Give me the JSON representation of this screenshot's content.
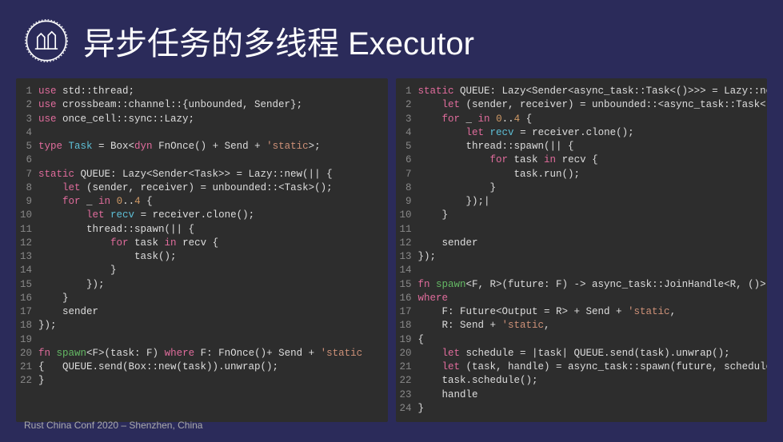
{
  "header": {
    "title": "异步任务的多线程 Executor"
  },
  "footer": {
    "text": "Rust China Conf 2020 – Shenzhen, China"
  },
  "left_code": [
    [
      {
        "t": "use ",
        "c": "kw"
      },
      {
        "t": "std::thread;",
        "c": ""
      }
    ],
    [
      {
        "t": "use ",
        "c": "kw"
      },
      {
        "t": "crossbeam::channel::{unbounded, Sender};",
        "c": ""
      }
    ],
    [
      {
        "t": "use ",
        "c": "kw"
      },
      {
        "t": "once_cell::sync::Lazy;",
        "c": ""
      }
    ],
    [
      {
        "t": "",
        "c": ""
      }
    ],
    [
      {
        "t": "type ",
        "c": "kw"
      },
      {
        "t": "Task",
        "c": "ty"
      },
      {
        "t": " = Box<",
        "c": ""
      },
      {
        "t": "dyn",
        "c": "kw"
      },
      {
        "t": " FnOnce() + Send + ",
        "c": ""
      },
      {
        "t": "'static",
        "c": "str"
      },
      {
        "t": ">;",
        "c": ""
      }
    ],
    [
      {
        "t": "",
        "c": ""
      }
    ],
    [
      {
        "t": "static ",
        "c": "kw"
      },
      {
        "t": "QUEUE: Lazy<Sender<Task>> = Lazy::new(|| {",
        "c": ""
      }
    ],
    [
      {
        "t": "    ",
        "c": ""
      },
      {
        "t": "let",
        "c": "kw"
      },
      {
        "t": " (sender, receiver) = unbounded::<Task>();",
        "c": ""
      }
    ],
    [
      {
        "t": "    ",
        "c": ""
      },
      {
        "t": "for",
        "c": "kw"
      },
      {
        "t": " _ ",
        "c": ""
      },
      {
        "t": "in",
        "c": "kw"
      },
      {
        "t": " ",
        "c": ""
      },
      {
        "t": "0",
        "c": "num"
      },
      {
        "t": "..",
        "c": ""
      },
      {
        "t": "4",
        "c": "num"
      },
      {
        "t": " {",
        "c": ""
      }
    ],
    [
      {
        "t": "        ",
        "c": ""
      },
      {
        "t": "let",
        "c": "kw"
      },
      {
        "t": " ",
        "c": ""
      },
      {
        "t": "recv",
        "c": "ty"
      },
      {
        "t": " = receiver.clone();",
        "c": ""
      }
    ],
    [
      {
        "t": "        thread::spawn(|| {",
        "c": ""
      }
    ],
    [
      {
        "t": "            ",
        "c": ""
      },
      {
        "t": "for",
        "c": "kw"
      },
      {
        "t": " task ",
        "c": ""
      },
      {
        "t": "in",
        "c": "kw"
      },
      {
        "t": " recv {",
        "c": ""
      }
    ],
    [
      {
        "t": "                task();",
        "c": ""
      }
    ],
    [
      {
        "t": "            }",
        "c": ""
      }
    ],
    [
      {
        "t": "        });",
        "c": ""
      }
    ],
    [
      {
        "t": "    }",
        "c": ""
      }
    ],
    [
      {
        "t": "    sender",
        "c": ""
      }
    ],
    [
      {
        "t": "});",
        "c": ""
      }
    ],
    [
      {
        "t": "",
        "c": ""
      }
    ],
    [
      {
        "t": "fn ",
        "c": "kw"
      },
      {
        "t": "spawn",
        "c": "fn"
      },
      {
        "t": "<F>(task: F) ",
        "c": ""
      },
      {
        "t": "where",
        "c": "kw"
      },
      {
        "t": " F: FnOnce()+ Send + ",
        "c": ""
      },
      {
        "t": "'static",
        "c": "str"
      }
    ],
    [
      {
        "t": "{   QUEUE.send(Box::new(task)).unwrap();",
        "c": ""
      }
    ],
    [
      {
        "t": "}",
        "c": ""
      }
    ]
  ],
  "right_code": [
    [
      {
        "t": "static ",
        "c": "kw"
      },
      {
        "t": "QUEUE: Lazy<Sender<async_task::Task<()>>> = Lazy::new(|| {",
        "c": ""
      }
    ],
    [
      {
        "t": "    ",
        "c": ""
      },
      {
        "t": "let",
        "c": "kw"
      },
      {
        "t": " (sender, receiver) = unbounded::<async_task::Task<()>>();",
        "c": ""
      }
    ],
    [
      {
        "t": "    ",
        "c": ""
      },
      {
        "t": "for",
        "c": "kw"
      },
      {
        "t": " _ ",
        "c": ""
      },
      {
        "t": "in",
        "c": "kw"
      },
      {
        "t": " ",
        "c": ""
      },
      {
        "t": "0",
        "c": "num"
      },
      {
        "t": "..",
        "c": ""
      },
      {
        "t": "4",
        "c": "num"
      },
      {
        "t": " {",
        "c": ""
      }
    ],
    [
      {
        "t": "        ",
        "c": ""
      },
      {
        "t": "let",
        "c": "kw"
      },
      {
        "t": " ",
        "c": ""
      },
      {
        "t": "recv",
        "c": "ty"
      },
      {
        "t": " = receiver.clone();",
        "c": ""
      }
    ],
    [
      {
        "t": "        thread::spawn(|| {",
        "c": ""
      }
    ],
    [
      {
        "t": "            ",
        "c": ""
      },
      {
        "t": "for",
        "c": "kw"
      },
      {
        "t": " task ",
        "c": ""
      },
      {
        "t": "in",
        "c": "kw"
      },
      {
        "t": " recv {",
        "c": ""
      }
    ],
    [
      {
        "t": "                task.run();",
        "c": ""
      }
    ],
    [
      {
        "t": "            }",
        "c": ""
      }
    ],
    [
      {
        "t": "        });|",
        "c": ""
      }
    ],
    [
      {
        "t": "    }",
        "c": ""
      }
    ],
    [
      {
        "t": "",
        "c": ""
      }
    ],
    [
      {
        "t": "    sender",
        "c": ""
      }
    ],
    [
      {
        "t": "});",
        "c": ""
      }
    ],
    [
      {
        "t": "",
        "c": ""
      }
    ],
    [
      {
        "t": "fn ",
        "c": "kw"
      },
      {
        "t": "spawn",
        "c": "fn"
      },
      {
        "t": "<F, R>(future: F) -> async_task::JoinHandle<R, ()>",
        "c": ""
      }
    ],
    [
      {
        "t": "where",
        "c": "kw"
      }
    ],
    [
      {
        "t": "    F: Future<Output = R> + Send + ",
        "c": ""
      },
      {
        "t": "'static",
        "c": "str"
      },
      {
        "t": ",",
        "c": ""
      }
    ],
    [
      {
        "t": "    R: Send + ",
        "c": ""
      },
      {
        "t": "'static",
        "c": "str"
      },
      {
        "t": ",",
        "c": ""
      }
    ],
    [
      {
        "t": "{",
        "c": ""
      }
    ],
    [
      {
        "t": "    ",
        "c": ""
      },
      {
        "t": "let",
        "c": "kw"
      },
      {
        "t": " schedule = |task| QUEUE.send(task).unwrap();",
        "c": ""
      }
    ],
    [
      {
        "t": "    ",
        "c": ""
      },
      {
        "t": "let",
        "c": "kw"
      },
      {
        "t": " (task, handle) = async_task::spawn(future, schedule, ());",
        "c": ""
      }
    ],
    [
      {
        "t": "    task.schedule();",
        "c": ""
      }
    ],
    [
      {
        "t": "    handle",
        "c": ""
      }
    ],
    [
      {
        "t": "}",
        "c": ""
      }
    ]
  ]
}
